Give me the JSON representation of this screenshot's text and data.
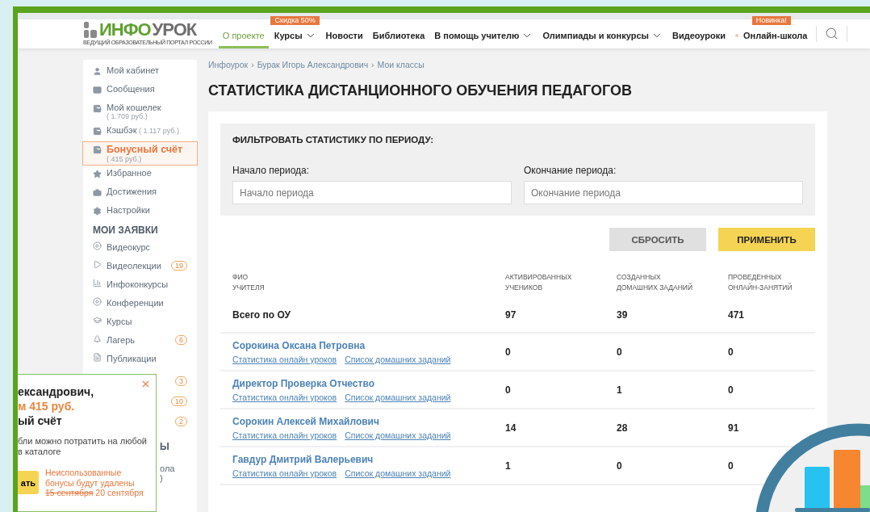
{
  "header": {
    "logo": {
      "accent": "ИНФО",
      "rest": "УРОК",
      "tagline": "ВЕДУЩИЙ ОБРАЗОВАТЕЛЬНЫЙ ПОРТАЛ РОССИИ"
    },
    "nav": [
      {
        "label": "О проекте",
        "selected": true
      },
      {
        "label": "Курсы",
        "selected": false,
        "dropdown": true,
        "badge": "Скидка 50%"
      },
      {
        "label": "Новости",
        "selected": false
      },
      {
        "label": "Библиотека",
        "selected": false
      },
      {
        "label": "В помощь учителю",
        "selected": false,
        "dropdown": true
      },
      {
        "label": "Олимпиады и конкурсы",
        "selected": false,
        "dropdown": true
      },
      {
        "label": "Видеоуроки",
        "selected": false
      },
      {
        "label": "Онлайн-школа",
        "selected": false,
        "dot": true,
        "badge": "Новинка!"
      }
    ]
  },
  "sidebar": {
    "items": [
      {
        "label": "Мой кабинет",
        "selected": false
      },
      {
        "label": "Сообщения",
        "selected": false
      },
      {
        "label": "Мой кошелек",
        "sub": "( 1.709 руб.)",
        "selected": false
      },
      {
        "label": "Кэшбэк",
        "inline_sub": "( 1.117 руб.)",
        "selected": false
      },
      {
        "label": "Бонусный счёт",
        "sub": "( 415 руб.)",
        "selected": true
      },
      {
        "label": "Избранное",
        "selected": false
      },
      {
        "label": "Достижения",
        "selected": false
      },
      {
        "label": "Настройки",
        "selected": false
      }
    ],
    "section_title": "МОИ ЗАЯВКИ",
    "requests": [
      {
        "label": "Видеокурс"
      },
      {
        "label": "Видеолекции",
        "count": "19"
      },
      {
        "label": "Инфоконкурсы"
      },
      {
        "label": "Конференции"
      },
      {
        "label": "Курсы"
      },
      {
        "label": "Лагерь",
        "count": "6"
      },
      {
        "label": "Публикации"
      },
      {
        "count": "3"
      },
      {
        "count": "10"
      },
      {
        "count": "2"
      }
    ],
    "partial_heading": "Ы",
    "partial_item": "ола",
    "partial_sub": ")"
  },
  "breadcrumbs": {
    "separator": "›",
    "items": [
      "Инфоурок",
      "Бурак Игорь Александрович",
      "Мои классы"
    ]
  },
  "page_title": "СТАТИСТИКА ДИСТАНЦИОННОГО ОБУЧЕНИЯ ПЕДАГОГОВ",
  "filter": {
    "title": "ФИЛЬТРОВАТЬ СТАТИСТИКУ ПО ПЕРИОДУ:",
    "fields": [
      {
        "label": "Начало периода:",
        "placeholder": "Начало периода"
      },
      {
        "label": "Окончание периода:",
        "placeholder": "Окончание периода"
      }
    ],
    "buttons": [
      {
        "label": "СБРОСИТЬ",
        "kind": "secondary"
      },
      {
        "label": "ПРИМЕНИТЬ",
        "kind": "primary"
      }
    ]
  },
  "table": {
    "columns": [
      [
        "ФИО",
        "УЧИТЕЛЯ"
      ],
      [
        "АКТИВИРОВАННЫХ",
        "УЧЕНИКОВ"
      ],
      [
        "СОЗДАННЫХ",
        "ДОМАШНИХ ЗАДАНИЙ"
      ],
      [
        "ПРОВЕДЕННЫХ",
        "ОНЛАЙН-ЗАНЯТИЙ"
      ]
    ],
    "total": {
      "name": "Всего по ОУ",
      "values": [
        "97",
        "39",
        "471"
      ]
    },
    "rows": [
      {
        "name": "Сорокина Оксана Петровна",
        "links": [
          "Статистика онлайн уроков",
          "Список домашних заданий"
        ],
        "values": [
          "0",
          "0",
          "0"
        ]
      },
      {
        "name": "Директор Проверка Отчество",
        "links": [
          "Статистика онлайн уроков",
          "Список домашних заданий"
        ],
        "values": [
          "0",
          "1",
          "0"
        ]
      },
      {
        "name": "Сорокин Алексей Михайлович",
        "links": [
          "Статистика онлайн уроков",
          "Список домашних заданий"
        ],
        "values": [
          "14",
          "28",
          "91"
        ]
      },
      {
        "name": "Гавдур Дмитрий Валерьевич",
        "links": [
          "Статистика онлайн уроков",
          "Список домашних заданий"
        ],
        "values": [
          "1",
          "0",
          "0"
        ]
      }
    ]
  },
  "popup": {
    "lines": [
      "ександрович,",
      "м 415 руб.",
      "ый счёт"
    ],
    "text": [
      "бли можно потратить на любой",
      "в каталоге"
    ],
    "button": "ать",
    "notice": "Неиспользованные бонусы будут удалены",
    "old_date": "15 сентября",
    "new_date": "20 сентября"
  }
}
